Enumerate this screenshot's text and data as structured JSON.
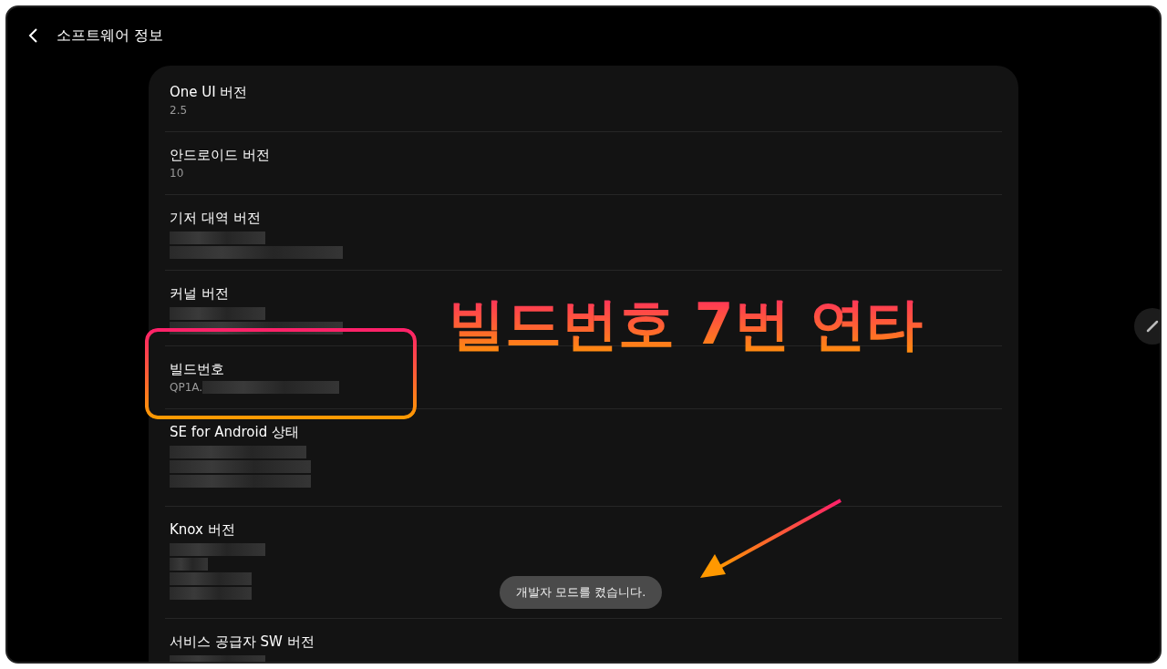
{
  "header": {
    "title": "소프트웨어 정보"
  },
  "rows": [
    {
      "kind": "value",
      "title": "One UI 버전",
      "value": "2.5",
      "highlighted": false
    },
    {
      "kind": "value",
      "title": "안드로이드 버전",
      "value": "10",
      "highlighted": false
    },
    {
      "kind": "redacted",
      "title": "기저 대역 버전",
      "highlighted": false
    },
    {
      "kind": "redacted",
      "title": "커널 버전",
      "highlighted": false
    },
    {
      "kind": "partial",
      "title": "빌드번호",
      "value": "QP1A.",
      "highlighted": true
    },
    {
      "kind": "redacted_block",
      "title": "SE for Android 상태",
      "highlighted": false
    },
    {
      "kind": "redacted_tall",
      "title": "Knox 버전",
      "highlighted": false
    },
    {
      "kind": "redacted",
      "title": "서비스 공급자 SW 버전",
      "highlighted": false
    }
  ],
  "annotation": {
    "callout": "빌드번호 7번 연타"
  },
  "toast": {
    "message": "개발자 모드를 켰습니다."
  }
}
